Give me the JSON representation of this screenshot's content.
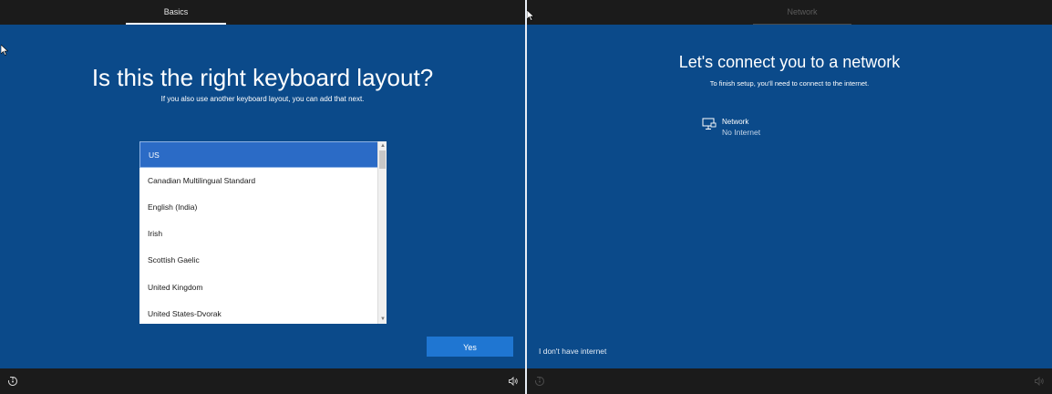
{
  "left_screen": {
    "tab_label": "Basics",
    "title": "Is this the right keyboard layout?",
    "subtitle": "If you also use another keyboard layout, you can add that next.",
    "layouts": [
      {
        "label": "US",
        "selected": true
      },
      {
        "label": "Canadian Multilingual Standard",
        "selected": false
      },
      {
        "label": "English (India)",
        "selected": false
      },
      {
        "label": "Irish",
        "selected": false
      },
      {
        "label": "Scottish Gaelic",
        "selected": false
      },
      {
        "label": "United Kingdom",
        "selected": false
      },
      {
        "label": "United States-Dvorak",
        "selected": false
      }
    ],
    "yes_label": "Yes",
    "bottom_icons": [
      "ease-of-access-icon",
      "volume-icon"
    ]
  },
  "right_screen": {
    "tab_label": "Network",
    "title": "Let's connect you to a network",
    "subtitle": "To finish setup, you'll need to connect to the internet.",
    "network": {
      "name": "Network",
      "status": "No Internet",
      "icon": "wired-network-icon"
    },
    "no_internet_label": "I don't have internet",
    "bottom_icons": [
      "ease-of-access-icon",
      "volume-icon"
    ]
  },
  "colors": {
    "background": "#0b4a8a",
    "bar": "#1b1b1b",
    "selected_item": "#2b6bc6",
    "button": "#1f76d2"
  }
}
